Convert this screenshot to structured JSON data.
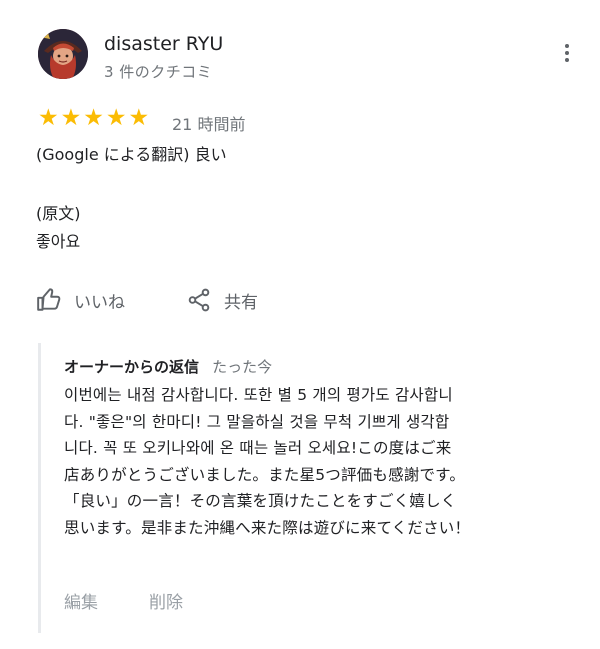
{
  "review": {
    "author_name": "disaster RYU",
    "review_count": "3 件のクチコミ",
    "rating": 5,
    "time": "21 時間前",
    "translated_text": "(Google による翻訳) 良い",
    "original_label": "(原文)",
    "original_text": "좋아요",
    "like_label": "いいね",
    "share_label": "共有",
    "icons": {
      "menu": "more-vertical-icon",
      "like": "thumbs-up-icon",
      "share": "share-icon",
      "star": "star-icon"
    },
    "star_color": "#fbbc04"
  },
  "owner_reply": {
    "title": "オーナーからの返信",
    "time": "たった今",
    "lines": [
      "이번에는 내점 감사합니다. 또한 별 5 개의 평가도 감사합니",
      "다. \"좋은\"의 한마디! 그 말을하실 것을 무척 기쁘게 생각합",
      "니다. 꼭 또 오키나와에 온 때는 놀러 오세요!この度はご来",
      "店ありがとうございました。また星5つ評価も感謝です。",
      "「良い」の一言！その言葉を頂けたことをすごく嬉しく",
      "思います。是非また沖縄へ来た際は遊びに来てください！"
    ],
    "edit_label": "編集",
    "delete_label": "削除"
  }
}
